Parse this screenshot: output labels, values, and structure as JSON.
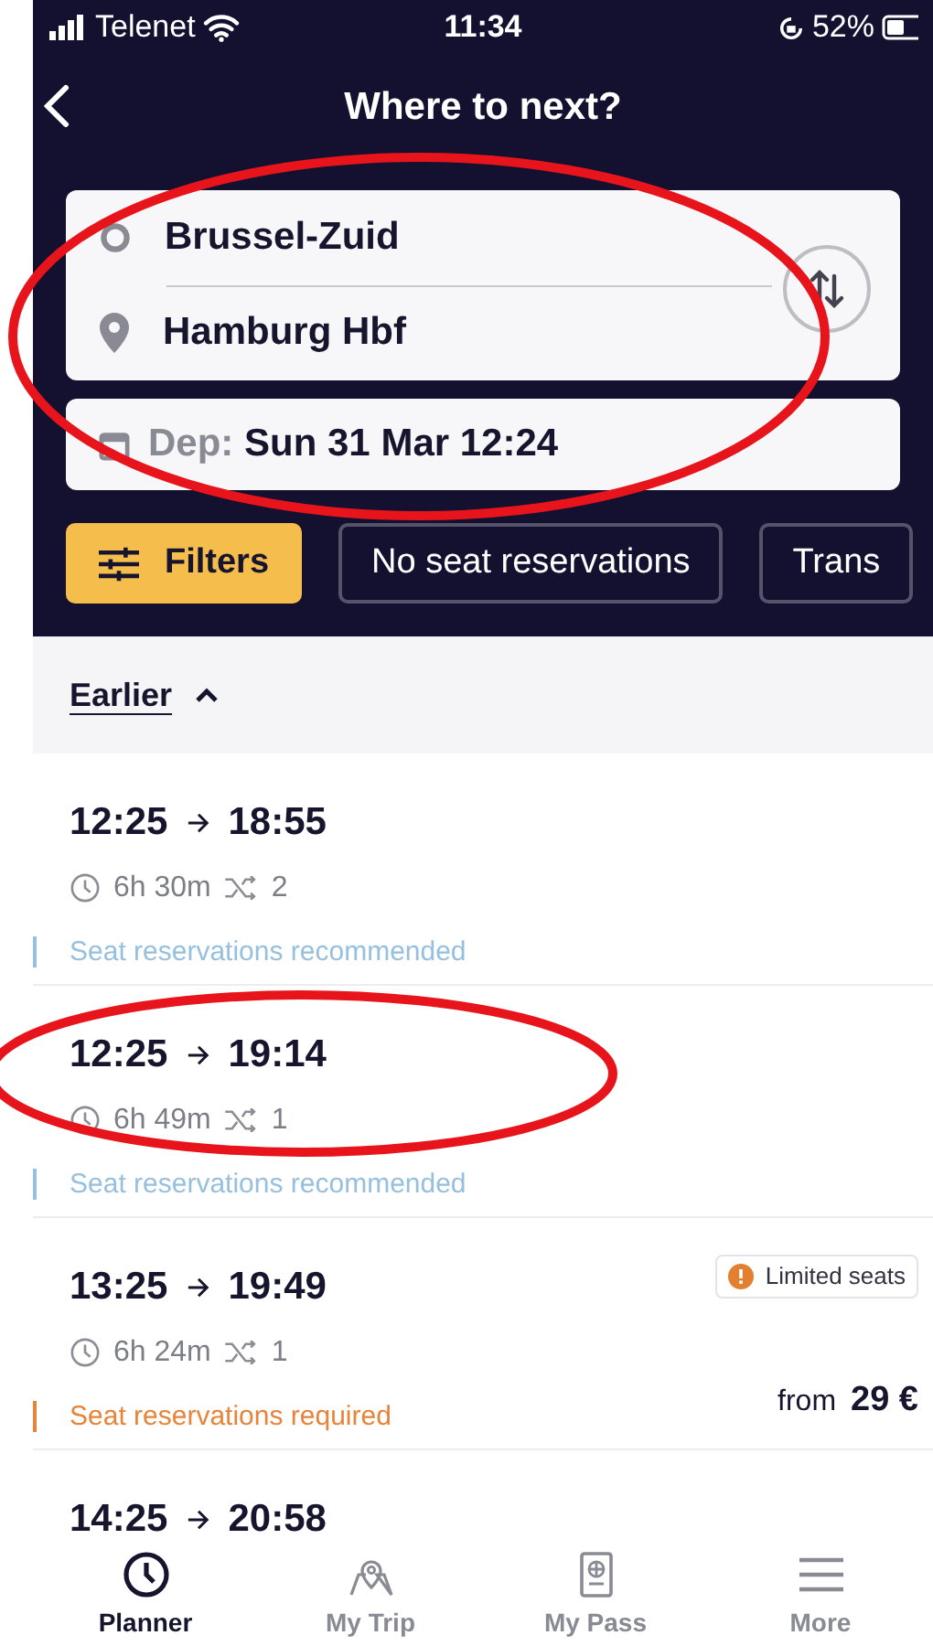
{
  "status_bar": {
    "carrier": "Telenet",
    "time": "11:34",
    "battery": "52%"
  },
  "header": {
    "title": "Where to next?"
  },
  "search": {
    "from": "Brussel-Zuid",
    "to": "Hamburg Hbf",
    "date_label": "Dep:",
    "date_value": "Sun 31 Mar 12:24"
  },
  "filters": [
    {
      "label": "Filters",
      "kind": "main"
    },
    {
      "label": "No seat reservations",
      "kind": "chip"
    },
    {
      "label": "Trans",
      "kind": "chip"
    }
  ],
  "earlier": {
    "label": "Earlier",
    "expanded": true
  },
  "journeys": [
    {
      "departure": "12:25",
      "arrival": "18:55",
      "duration": "6h 30m",
      "changes": "2",
      "note": {
        "text": "Seat reservations recommended",
        "kind": "recommended"
      }
    },
    {
      "departure": "12:25",
      "arrival": "19:14",
      "duration": "6h 49m",
      "changes": "1",
      "note": {
        "text": "Seat reservations recommended",
        "kind": "recommended"
      }
    },
    {
      "departure": "13:25",
      "arrival": "19:49",
      "duration": "6h 24m",
      "changes": "1",
      "badge": "Limited seats",
      "note": {
        "text": "Seat reservations required",
        "kind": "required"
      },
      "price_prefix": "from",
      "price": "29 €"
    },
    {
      "departure": "14:25",
      "arrival": "20:58"
    }
  ],
  "tab_bar": [
    {
      "label": "Planner",
      "selected": true,
      "kind": "clock"
    },
    {
      "label": "My Trip",
      "selected": false,
      "kind": "map"
    },
    {
      "label": "My Pass",
      "selected": false,
      "kind": "pass"
    },
    {
      "label": "More",
      "selected": false,
      "kind": "menu"
    }
  ],
  "annotations": [
    {
      "kind": "ellipse",
      "color": "#e8141b"
    },
    {
      "kind": "ellipse",
      "color": "#e8141b"
    }
  ]
}
